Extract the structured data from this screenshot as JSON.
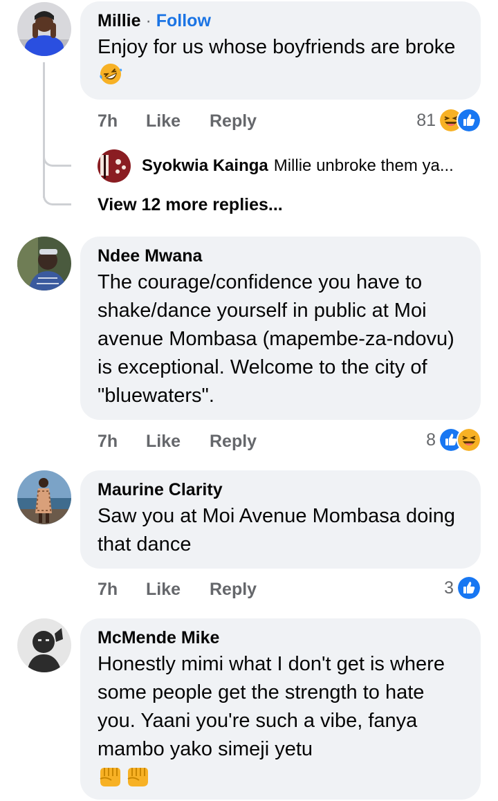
{
  "comments": [
    {
      "author": "Millie",
      "separator": "·",
      "follow_label": "Follow",
      "text": "Enjoy for us whose boyfriends are broke",
      "emoji": "rolling-on-floor-laughing",
      "time": "7h",
      "like_label": "Like",
      "reply_label": "Reply",
      "reaction_count": "81",
      "reactions": [
        "haha-icon",
        "like-icon"
      ]
    },
    {
      "author": "Ndee Mwana",
      "text": "The courage/confidence you have to shake/dance yourself in public at Moi avenue Mombasa (mapembe-za-ndovu) is exceptional. Welcome to the city of \"bluewaters\".",
      "time": "7h",
      "like_label": "Like",
      "reply_label": "Reply",
      "reaction_count": "8",
      "reactions": [
        "like-icon",
        "haha-icon"
      ]
    },
    {
      "author": "Maurine Clarity",
      "text": "Saw you at Moi Avenue Mombasa doing that dance",
      "time": "7h",
      "like_label": "Like",
      "reply_label": "Reply",
      "reaction_count": "3",
      "reactions": [
        "like-icon"
      ]
    },
    {
      "author": "McMende Mike",
      "text": "Honestly mimi what I don't get is where some people get the strength to hate you.  Yaani you're such a vibe, fanya mambo yako simeji yetu",
      "emoji": "oncoming-fist x2"
    }
  ],
  "reply_preview": {
    "author": "Syokwia Kainga",
    "text": "Millie unbroke them ya..."
  },
  "view_more_label": "View 12 more replies...",
  "colors": {
    "bubble": "#f0f2f5",
    "link": "#1b74e4",
    "muted": "#65676b",
    "like_blue": "#1877f2",
    "haha_yellow": "#f7b125"
  }
}
